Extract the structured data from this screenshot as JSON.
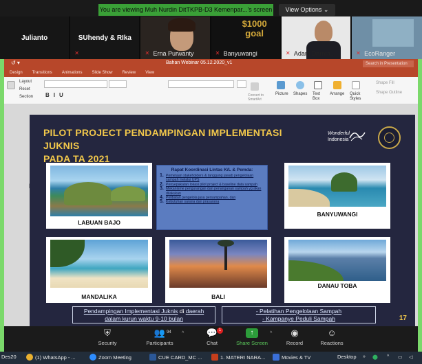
{
  "zoom": {
    "viewing_banner": "You are viewing Muh Nurdin DitTKPB-D3 Kemenpar...'s screen",
    "view_options": "View Options"
  },
  "gallery": [
    {
      "name": "Julianto",
      "label": ""
    },
    {
      "name": "SUhendy & RIka",
      "label": ""
    },
    {
      "name": "",
      "label": "Erna Purwanty"
    },
    {
      "name": "",
      "label": "Banyuwangi"
    },
    {
      "name": "",
      "label": "Adam Darma..."
    },
    {
      "name": "",
      "label": "EcoRanger"
    }
  ],
  "ppt": {
    "doc_title": "Bahan Webinar 05.12.2020_v1",
    "search_placeholder": "Search in Presentation",
    "tabs": [
      "Design",
      "Transitions",
      "Animations",
      "Slide Show",
      "Review",
      "View"
    ],
    "ribbon": {
      "layout": "Layout",
      "reset": "Reset",
      "section": "Section",
      "convert_smartart": "Convert to SmartArt",
      "picture": "Picture",
      "shapes": "Shapes",
      "text_box": "Text Box",
      "arrange": "Arrange",
      "quick_styles": "Quick Styles",
      "shape_fill": "Shape Fill",
      "shape_outline": "Shape Outline"
    }
  },
  "slide": {
    "title_line1": "PILOT PROJECT PENDAMPINGAN IMPLEMENTASI JUKNIS",
    "title_line2": "PADA TA 2021",
    "brand_line1": "Wonderful",
    "brand_line2": "Indonesia",
    "photos": [
      {
        "caption": "LABUAN BAJO"
      },
      {
        "caption": "BANYUWANGI"
      },
      {
        "caption": "MANDALIKA"
      },
      {
        "caption": "BALI"
      },
      {
        "caption": "DANAU TOBA"
      }
    ],
    "coordination": {
      "title": "Rapat Koordinasi Lintas K/L & Pemda:",
      "items": [
        {
          "num": "1.",
          "text": "Pemetaan stakeholders & tanggung jawab pengelolaan sampah melalui UPS"
        },
        {
          "num": "2.",
          "text": "Penyepakatan lokasi pilot project & baseline data sampah"
        },
        {
          "num": "3.",
          "text": "Mekanisme pengurangan dan penanganan sampah yg akan dilakukan"
        },
        {
          "num": "4.",
          "text": "Pelibatan pengelola jasa persampahan, dan"
        },
        {
          "num": "5.",
          "text": "Kebutuhan sarana dan prasarana"
        }
      ]
    },
    "bottom_left_line1_u": "Pendampingan Implementasi Juknis",
    "bottom_left_line1_mid": " di ",
    "bottom_left_line1_u2": "daerah",
    "bottom_left_line2": "dalam kurun waktu 9-10 bulan",
    "bottom_right_line1": "- Pelatihan Pengelolaan Sampah",
    "bottom_right_line2": "- Kampanye Peduli Sampah",
    "page_number": "17"
  },
  "toolbar": {
    "security": "Security",
    "participants": "Participants",
    "participants_count": "94",
    "chat": "Chat",
    "chat_badge": "1",
    "share_screen": "Share Screen",
    "record": "Record",
    "reactions": "Reactions"
  },
  "taskbar": {
    "left_fragment": "Des20",
    "items": [
      {
        "label": "(1) WhatsApp - ..."
      },
      {
        "label": "Zoom Meeting"
      },
      {
        "label": "CUE CARD_MC ..."
      },
      {
        "label": "1. MATERI NARA..."
      },
      {
        "label": "Movies & TV"
      }
    ],
    "desktop": "Desktop"
  }
}
